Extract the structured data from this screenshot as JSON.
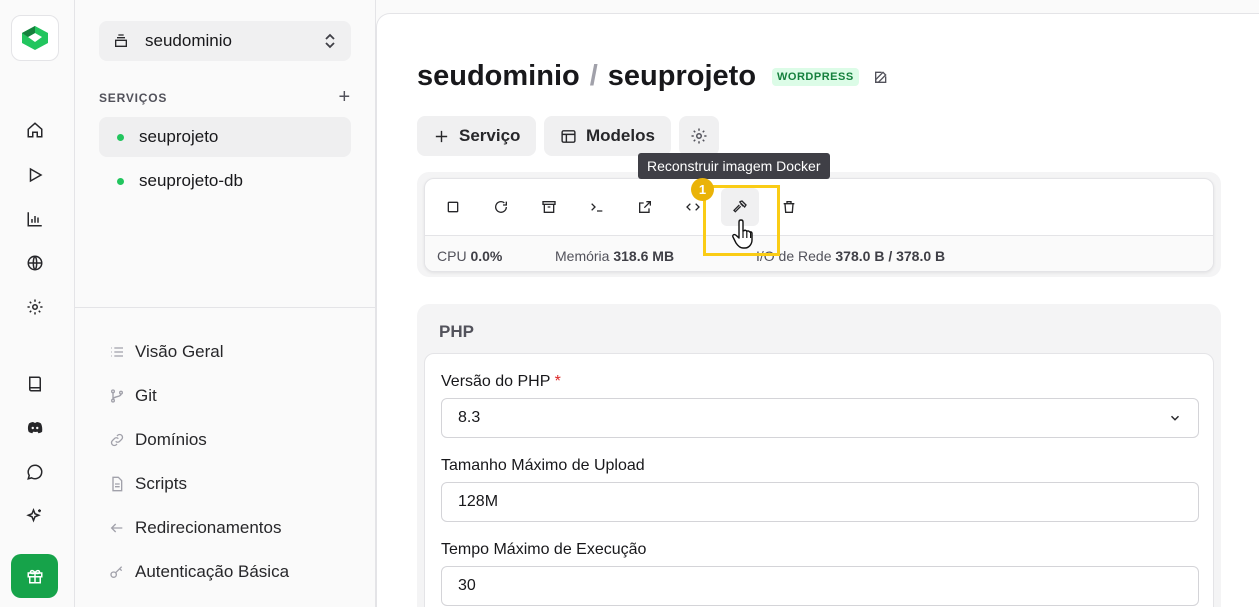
{
  "sidebar": {
    "environment": "seudominio",
    "services_header": "SERVIÇOS",
    "add_label": "+",
    "services": [
      {
        "name": "seuprojeto"
      },
      {
        "name": "seuprojeto-db"
      }
    ],
    "nav": [
      {
        "label": "Visão Geral",
        "icon": "list-icon"
      },
      {
        "label": "Git",
        "icon": "git-branch-icon"
      },
      {
        "label": "Domínios",
        "icon": "link-icon"
      },
      {
        "label": "Scripts",
        "icon": "file-icon"
      },
      {
        "label": "Redirecionamentos",
        "icon": "arrow-left-icon"
      },
      {
        "label": "Autenticação Básica",
        "icon": "key-icon"
      }
    ]
  },
  "header": {
    "project": "seudominio",
    "separator": "/",
    "service": "seuprojeto",
    "badge": "WORDPRESS"
  },
  "actions": {
    "service_label": "Serviço",
    "templates_label": "Modelos"
  },
  "tooltip": "Reconstruir imagem Docker",
  "annotation_step": "1",
  "metrics": {
    "cpu_label": "CPU",
    "cpu_value": "0.0%",
    "memory_label": "Memória",
    "memory_value": "318.6 MB",
    "network_label": "I/O de Rede",
    "network_value": "378.0 B / 378.0 B"
  },
  "php": {
    "section_title": "PHP",
    "version_label": "Versão do PHP",
    "required_mark": "*",
    "version_value": "8.3",
    "upload_label": "Tamanho Máximo de Upload",
    "upload_value": "128M",
    "exec_label": "Tempo Máximo de Execução",
    "exec_value": "30"
  },
  "colors": {
    "accent_green": "#22c55e",
    "gift_green": "#16a34a",
    "highlight_yellow": "#facc15",
    "badge_bg": "#dcfce7",
    "badge_text": "#15803d"
  }
}
